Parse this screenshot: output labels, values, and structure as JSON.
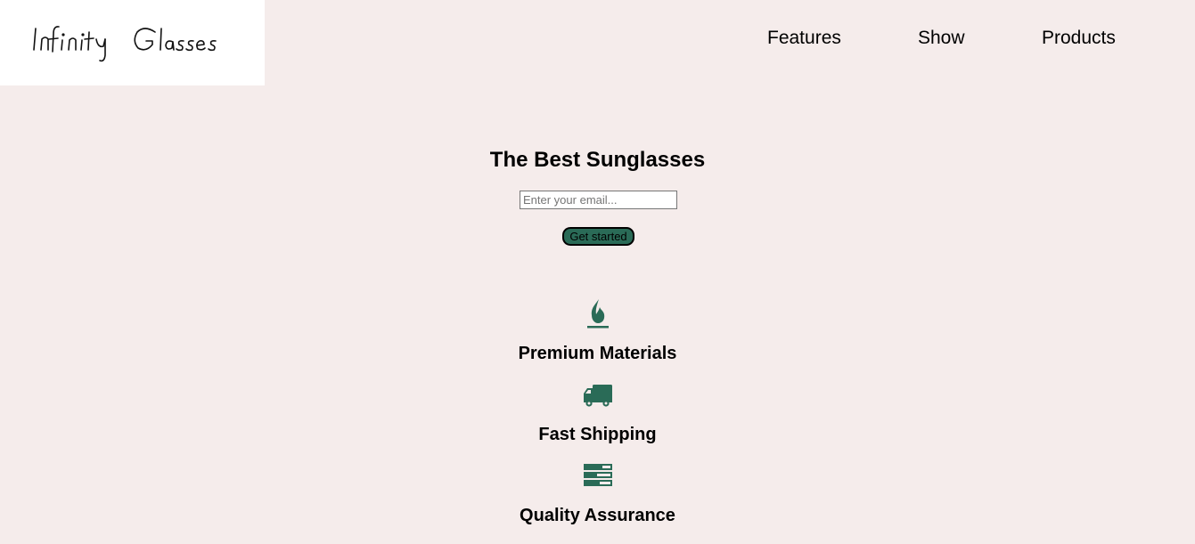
{
  "header": {
    "logo_text": "Infinity Glasses",
    "nav": [
      {
        "label": "Features"
      },
      {
        "label": "Show"
      },
      {
        "label": "Products"
      }
    ]
  },
  "hero": {
    "title": "The Best Sunglasses",
    "email_placeholder": "Enter your email...",
    "cta_label": "Get started"
  },
  "features": [
    {
      "icon": "fire-icon",
      "title": "Premium Materials"
    },
    {
      "icon": "truck-icon",
      "title": "Fast Shipping"
    },
    {
      "icon": "battery-icon",
      "title": "Quality Assurance"
    }
  ],
  "colors": {
    "background": "#f5eceb",
    "accent": "#2a6b57",
    "logo_bg": "#ffffff"
  }
}
